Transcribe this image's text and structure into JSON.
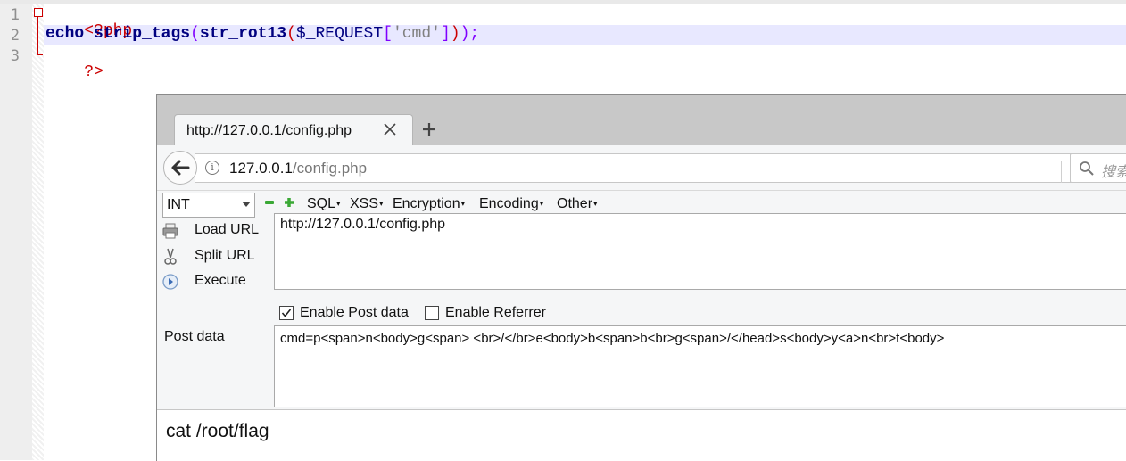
{
  "editor": {
    "line_numbers": [
      "1",
      "2",
      "3"
    ],
    "line1": {
      "open_tag": "<?php"
    },
    "line2": {
      "echo": "echo",
      "strip_tags": "strip_tags",
      "lparen1": "(",
      "str_rot13": "str_rot13",
      "lparen2": "(",
      "var": "$_REQUEST",
      "lbracket": "[",
      "key": "'cmd'",
      "rbracket": "]",
      "rparen2": ")",
      "rparen1": ")",
      "semi": ";"
    },
    "line3": {
      "close_tag": "?>"
    }
  },
  "browser": {
    "tab_title": "http://127.0.0.1/config.php",
    "url_host": "127.0.0.1",
    "url_path": "/config.php",
    "search_placeholder": "搜索",
    "hackbar": {
      "select_value": "INT",
      "menus": [
        "SQL",
        "XSS",
        "Encryption",
        "Encoding",
        "Other"
      ],
      "load_url": "Load URL",
      "split_url": "Split URL",
      "execute": "Execute",
      "url_value": "http://127.0.0.1/config.php",
      "enable_post": "Enable Post data",
      "enable_post_checked": true,
      "enable_referrer": "Enable Referrer",
      "enable_referrer_checked": false,
      "post_label": "Post data",
      "post_value": "cmd=p<span>n<body>g<span> <br>/</br>e<body>b<span>b<br>g<span>/</head>s<body>y<a>n<br>t<body>"
    },
    "page_output": "cat /root/flag"
  },
  "colors": {
    "php_tag": "#cc0000",
    "keyword": "#000080",
    "paren": "#8000ff",
    "string": "#808080",
    "current_line": "#e8e8ff",
    "tabstrip": "#c8c8c8"
  }
}
